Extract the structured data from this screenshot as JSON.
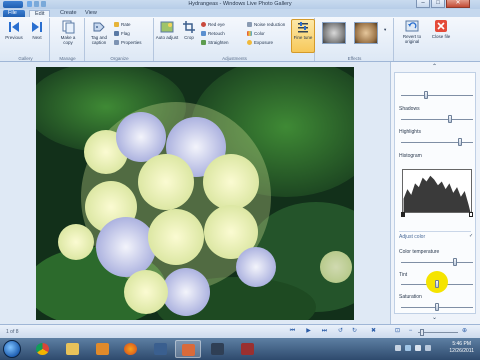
{
  "window": {
    "title": "Hydrangeas - Windows Live Photo Gallery",
    "minimize_glyph": "‒",
    "maximize_glyph": "□",
    "close_glyph": "✕"
  },
  "tabs": [
    {
      "label": "File"
    },
    {
      "label": "Edit"
    },
    {
      "label": "Create"
    },
    {
      "label": "View"
    }
  ],
  "ribbon": {
    "groups": {
      "gallery": "Gallery",
      "manage": "Manage",
      "organize": "Organize",
      "adjustments": "Adjustments",
      "effects": "Effects"
    },
    "previous": "Previous",
    "next": "Next",
    "make_copy": "Make a copy",
    "tag_caption": "Tag and caption",
    "rate": "Rate",
    "flag": "Flag",
    "properties": "Properties",
    "auto_adjust": "Auto adjust",
    "crop": "Crop",
    "red_eye": "Red eye",
    "retouch": "Retouch",
    "straighten": "Straighten",
    "noise_reduction": "Noise reduction",
    "color": "Color",
    "exposure": "Exposure",
    "fine_tune": "Fine tune",
    "revert": "Revert to original",
    "close_file": "Close file"
  },
  "panel": {
    "shadows": "Shadows",
    "highlights": "Highlights",
    "histogram": "Histogram",
    "adjust_color": "Adjust color",
    "color_temperature": "Color temperature",
    "tint": "Tint",
    "saturation": "Saturation",
    "levels": {
      "top_slider": 0.35,
      "shadows": 0.68,
      "highlights": 0.82,
      "color_temperature": 0.75,
      "tint": 0.5,
      "saturation": 0.5
    }
  },
  "statusbar": {
    "count": "1 of 8",
    "zoom_glyph": "⊕"
  },
  "taskbar": {
    "time": "5:46 PM",
    "date": "12/26/2011"
  },
  "colors": {
    "accent": "#1f5fb2",
    "ribbon_bg": "#e7eff9",
    "highlight_cursor": "#f5e400"
  }
}
